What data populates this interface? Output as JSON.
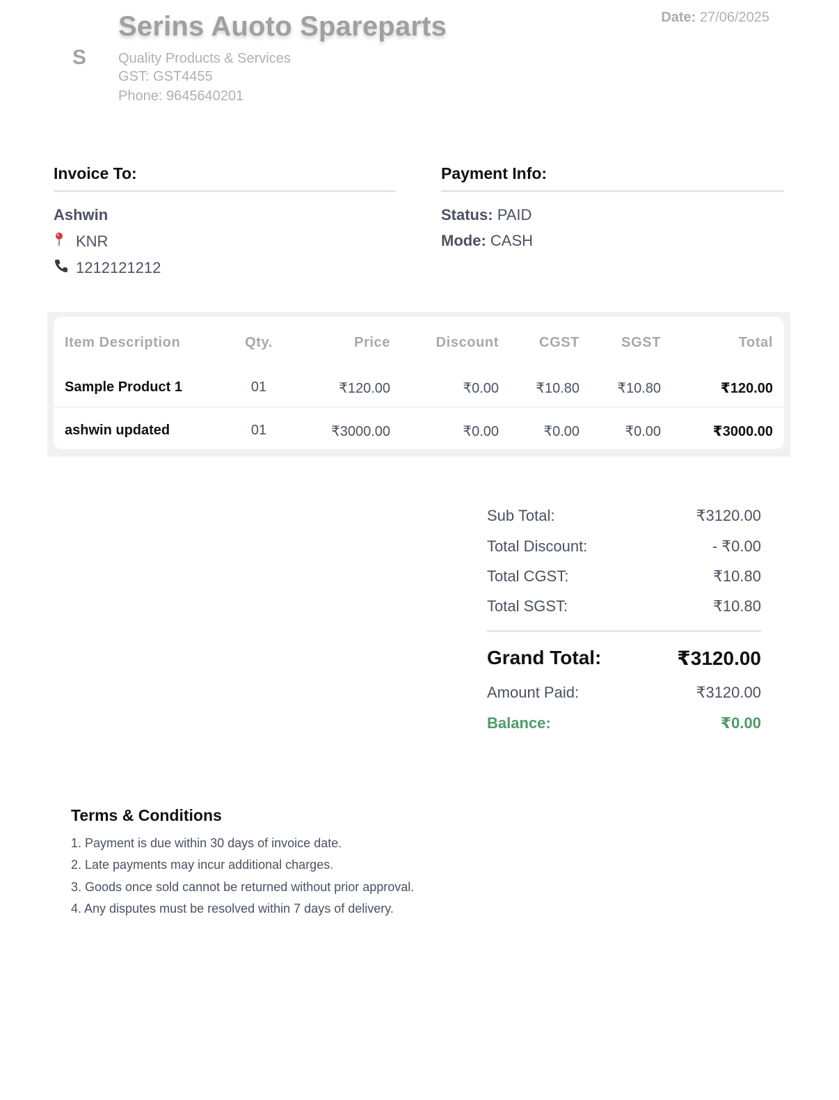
{
  "company": {
    "logo_letter": "S",
    "name": "Serins Auoto Spareparts",
    "tagline": "Quality Products & Services",
    "gst": "GST: GST4455",
    "phone": "Phone: 9645640201"
  },
  "date": {
    "label": "Date:",
    "value": "27/06/2025"
  },
  "invoice_to": {
    "heading": "Invoice To:",
    "name": "Ashwin",
    "address": "KNR",
    "phone": "1212121212",
    "address_icon": "pin-icon",
    "phone_icon": "phone-icon"
  },
  "payment_info": {
    "heading": "Payment Info:",
    "status_label": "Status:",
    "status_value": "PAID",
    "mode_label": "Mode:",
    "mode_value": "CASH"
  },
  "table": {
    "headers": [
      "Item Description",
      "Qty.",
      "Price",
      "Discount",
      "CGST",
      "SGST",
      "Total"
    ],
    "rows": [
      [
        "Sample Product 1",
        "01",
        "₹120.00",
        "₹0.00",
        "₹10.80",
        "₹10.80",
        "₹120.00"
      ],
      [
        "ashwin updated",
        "01",
        "₹3000.00",
        "₹0.00",
        "₹0.00",
        "₹0.00",
        "₹3000.00"
      ]
    ]
  },
  "summary": {
    "sub_total_label": "Sub Total:",
    "sub_total": "₹3120.00",
    "discount_label": "Total Discount:",
    "discount": "- ₹0.00",
    "cgst_label": "Total CGST:",
    "cgst": "₹10.80",
    "sgst_label": "Total SGST:",
    "sgst": "₹10.80",
    "grand_total_label": "Grand Total:",
    "grand_total": "₹3120.00",
    "amount_paid_label": "Amount Paid:",
    "amount_paid": "₹3120.00",
    "balance_label": "Balance:",
    "balance": "₹0.00"
  },
  "terms": {
    "title": "Terms & Conditions",
    "items": [
      "1. Payment is due within 30 days of invoice date.",
      "2. Late payments may incur additional charges.",
      "3. Goods once sold cannot be returned without prior approval.",
      "4. Any disputes must be resolved within 7 days of delivery."
    ]
  },
  "colors": {
    "balance": "#4e9b6a",
    "body_text": "#4b5161",
    "muted": "#a8a8a8",
    "rule": "#e4e6ee"
  }
}
